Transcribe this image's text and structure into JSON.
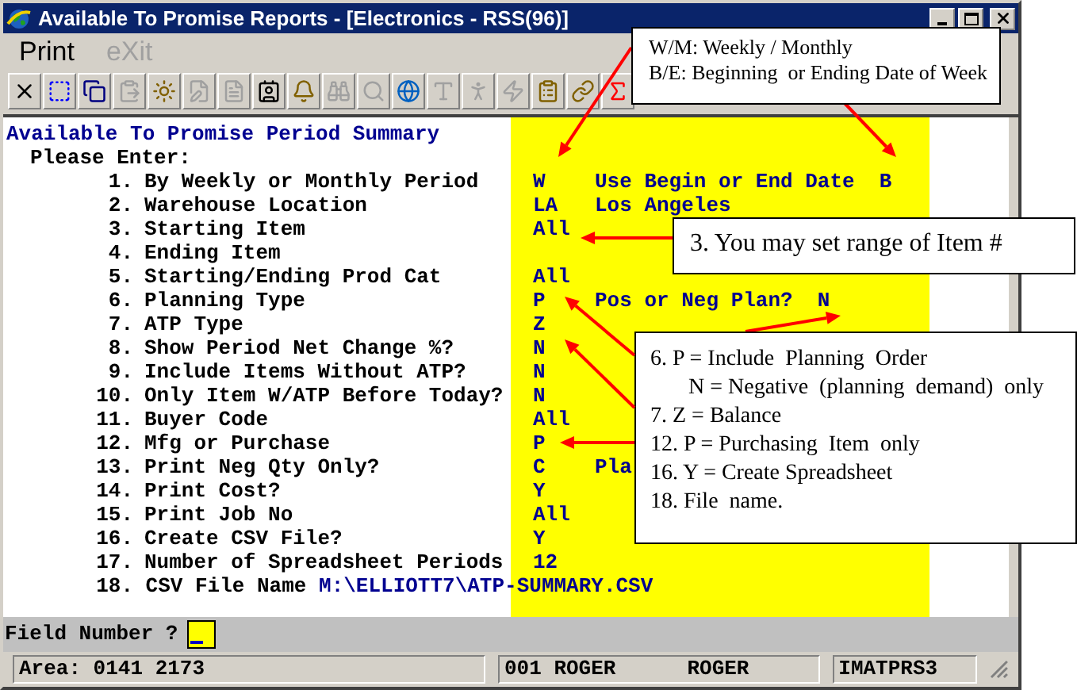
{
  "window": {
    "title": "Available To Promise Reports - [Electronics - RSS(96)]"
  },
  "menu": [
    {
      "label": "Print",
      "disabled": false
    },
    {
      "label": "eXit",
      "disabled": true
    }
  ],
  "toolbar": [
    {
      "disabled": false
    },
    {
      "disabled": false
    },
    {
      "disabled": false
    },
    {
      "disabled": true
    },
    {
      "disabled": false
    },
    {
      "disabled": true
    },
    {
      "disabled": true
    },
    {
      "disabled": false
    },
    {
      "disabled": false
    },
    {
      "disabled": true
    },
    {
      "disabled": true
    },
    {
      "disabled": false
    },
    {
      "disabled": true
    },
    {
      "disabled": true
    },
    {
      "disabled": true
    },
    {
      "disabled": false
    },
    {
      "disabled": false
    },
    {
      "disabled": false
    }
  ],
  "screen": {
    "heading": "Available To Promise Period Summary",
    "prompt": "Please Enter:",
    "fields": [
      {
        "kind": "field",
        "number": "1.",
        "label": "By Weekly or Monthly Period",
        "value": "W",
        "note": "Use Begin or End Date",
        "note_value": "B"
      },
      {
        "kind": "field",
        "number": "2.",
        "label": "Warehouse Location",
        "value": "LA",
        "note": "Los Angeles"
      },
      {
        "kind": "field",
        "number": "3.",
        "label": "Starting Item",
        "value": "All"
      },
      {
        "kind": "field",
        "number": "4.",
        "label": "Ending Item"
      },
      {
        "kind": "field",
        "number": "5.",
        "label": "Starting/Ending Prod Cat",
        "value": "All"
      },
      {
        "kind": "field",
        "number": "6.",
        "label": "Planning Type",
        "value": "P",
        "note": "Pos or Neg Plan?",
        "note_value": "N"
      },
      {
        "kind": "field",
        "number": "7.",
        "label": "ATP Type",
        "value": "Z"
      },
      {
        "kind": "field",
        "number": "8.",
        "label": "Show Period Net Change %?",
        "value": "N"
      },
      {
        "kind": "field",
        "number": "9.",
        "label": "Include Items Without ATP?",
        "value": "N"
      },
      {
        "kind": "field",
        "number": "10.",
        "label": "Only Item W/ATP Before Today?",
        "value": "N"
      },
      {
        "kind": "field",
        "number": "11.",
        "label": "Buyer Code",
        "value": "All"
      },
      {
        "kind": "field",
        "number": "12.",
        "label": "Mfg or Purchase",
        "value": "P"
      },
      {
        "kind": "field",
        "number": "13.",
        "label": "Print Neg Qty Only?",
        "value": "C",
        "note": "Pla"
      },
      {
        "kind": "field",
        "number": "14.",
        "label": "Print Cost?",
        "value": "Y"
      },
      {
        "kind": "field",
        "number": "15.",
        "label": "Print Job No",
        "value": "All"
      },
      {
        "kind": "field",
        "number": "16.",
        "label": "Create CSV File?",
        "value": "Y"
      },
      {
        "kind": "field",
        "number": "17.",
        "label": "Number of Spreadsheet Periods",
        "value": "12"
      },
      {
        "kind": "inline",
        "number": "18.",
        "label": "CSV File Name",
        "value": "M:\\ELLIOTT7\\ATP-SUMMARY.CSV"
      }
    ]
  },
  "field_prompt": {
    "label": "Field Number ?"
  },
  "status_bar": [
    "Area: 0141 2173",
    "001 ROGER",
    "ROGER",
    "IMATPRS3"
  ],
  "callouts": [
    {
      "lines": [
        {
          "text": "W/M: Weekly / Monthly",
          "indent": false
        },
        {
          "text": "B/E: Beginning  or Ending Date of Week",
          "indent": false
        }
      ]
    },
    {
      "lines": [
        {
          "text": "3. You may set range of Item #",
          "indent": false
        }
      ]
    },
    {
      "lines": [
        {
          "text": "6. P = Include  Planning  Order",
          "indent": false
        },
        {
          "text": "N = Negative  (planning  demand)  only",
          "indent": true
        },
        {
          "text": "7. Z = Balance",
          "indent": false
        },
        {
          "text": "12. P = Purchasing  Item  only",
          "indent": false
        },
        {
          "text": "16. Y = Create Spreadsheet",
          "indent": false
        },
        {
          "text": "18. File  name.",
          "indent": false
        }
      ]
    }
  ]
}
